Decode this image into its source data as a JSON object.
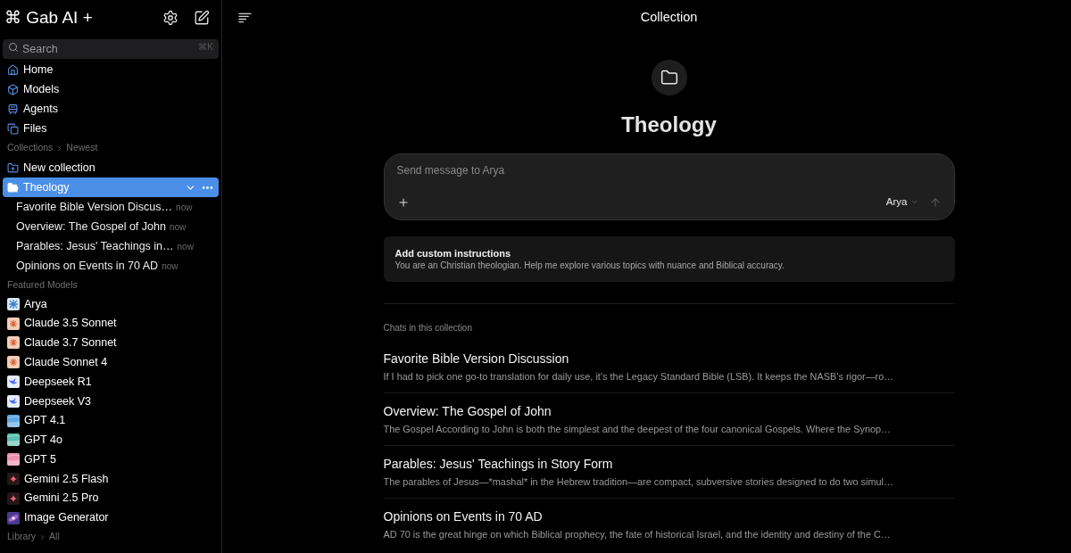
{
  "sidebar": {
    "brand": "⌘ Gab AI +",
    "search": {
      "placeholder": "Search",
      "shortcut": "⌘K"
    },
    "nav": [
      {
        "label": "Home"
      },
      {
        "label": "Models"
      },
      {
        "label": "Agents"
      },
      {
        "label": "Files"
      }
    ],
    "collections_heading": {
      "label": "Collections",
      "sort": "Newest"
    },
    "new_collection": "New collection",
    "collections": [
      {
        "name": "Theology",
        "selected": true,
        "expanded": true,
        "chats": [
          {
            "title": "Favorite Bible Version Discus…",
            "time": "now"
          },
          {
            "title": "Overview: The Gospel of John",
            "time": "now"
          },
          {
            "title": "Parables: Jesus' Teachings in…",
            "time": "now"
          },
          {
            "title": "Opinions on Events in 70 AD",
            "time": "now"
          }
        ]
      }
    ],
    "featured_heading": "Featured Models",
    "models": [
      {
        "name": "Arya",
        "kind": "arya",
        "color": "#d9eaf7"
      },
      {
        "name": "Claude 3.5 Sonnet",
        "kind": "claude",
        "color": "#f3cdb8"
      },
      {
        "name": "Claude 3.7 Sonnet",
        "kind": "claude",
        "color": "#f3cdb8"
      },
      {
        "name": "Claude Sonnet 4",
        "kind": "claude",
        "color": "#f3cdb8"
      },
      {
        "name": "Deepseek R1",
        "kind": "deepseek",
        "color": "#e6ebfb"
      },
      {
        "name": "Deepseek V3",
        "kind": "deepseek",
        "color": "#e6ebfb"
      },
      {
        "name": "GPT 4.1",
        "kind": "gpt",
        "color": "#5ea6e3"
      },
      {
        "name": "GPT 4o",
        "kind": "gpt",
        "color": "#5cbfae"
      },
      {
        "name": "GPT 5",
        "kind": "gpt",
        "color": "#ec8fae"
      },
      {
        "name": "Gemini 2.5 Flash",
        "kind": "gemini",
        "color": "#241818"
      },
      {
        "name": "Gemini 2.5 Pro",
        "kind": "gemini",
        "color": "#241818"
      },
      {
        "name": "Image Generator",
        "kind": "galaxy",
        "color": "#4b3c8e"
      }
    ],
    "library_heading": {
      "label": "Library",
      "filter": "All"
    }
  },
  "main": {
    "title": "Collection",
    "collection_name": "Theology",
    "composer": {
      "placeholder": "Send message to Arya",
      "model": "Arya"
    },
    "instructions": {
      "title": "Add custom instructions",
      "text": "You are an Christian theologian. Help me explore various topics with nuance and Biblical accuracy."
    },
    "chats_heading": "Chats in this collection",
    "chats": [
      {
        "title": "Favorite Bible Version Discussion",
        "preview": "If I had to pick one go-to translation for daily use, it’s the Legacy Standard Bible (LSB). It keeps the NASB’s rigor—ro…"
      },
      {
        "title": "Overview: The Gospel of John",
        "preview": "The Gospel According to John is both the simplest and the deepest of the four canonical Gospels. Where the Synop…"
      },
      {
        "title": "Parables: Jesus' Teachings in Story Form",
        "preview": "The parables of Jesus—*mashal* in the Hebrew tradition—are compact, subversive stories designed to do two simul…"
      },
      {
        "title": "Opinions on Events in 70 AD",
        "preview": "AD 70 is the great hinge on which Biblical prophecy, the fate of historical Israel, and the identity and destiny of the C…"
      }
    ]
  }
}
